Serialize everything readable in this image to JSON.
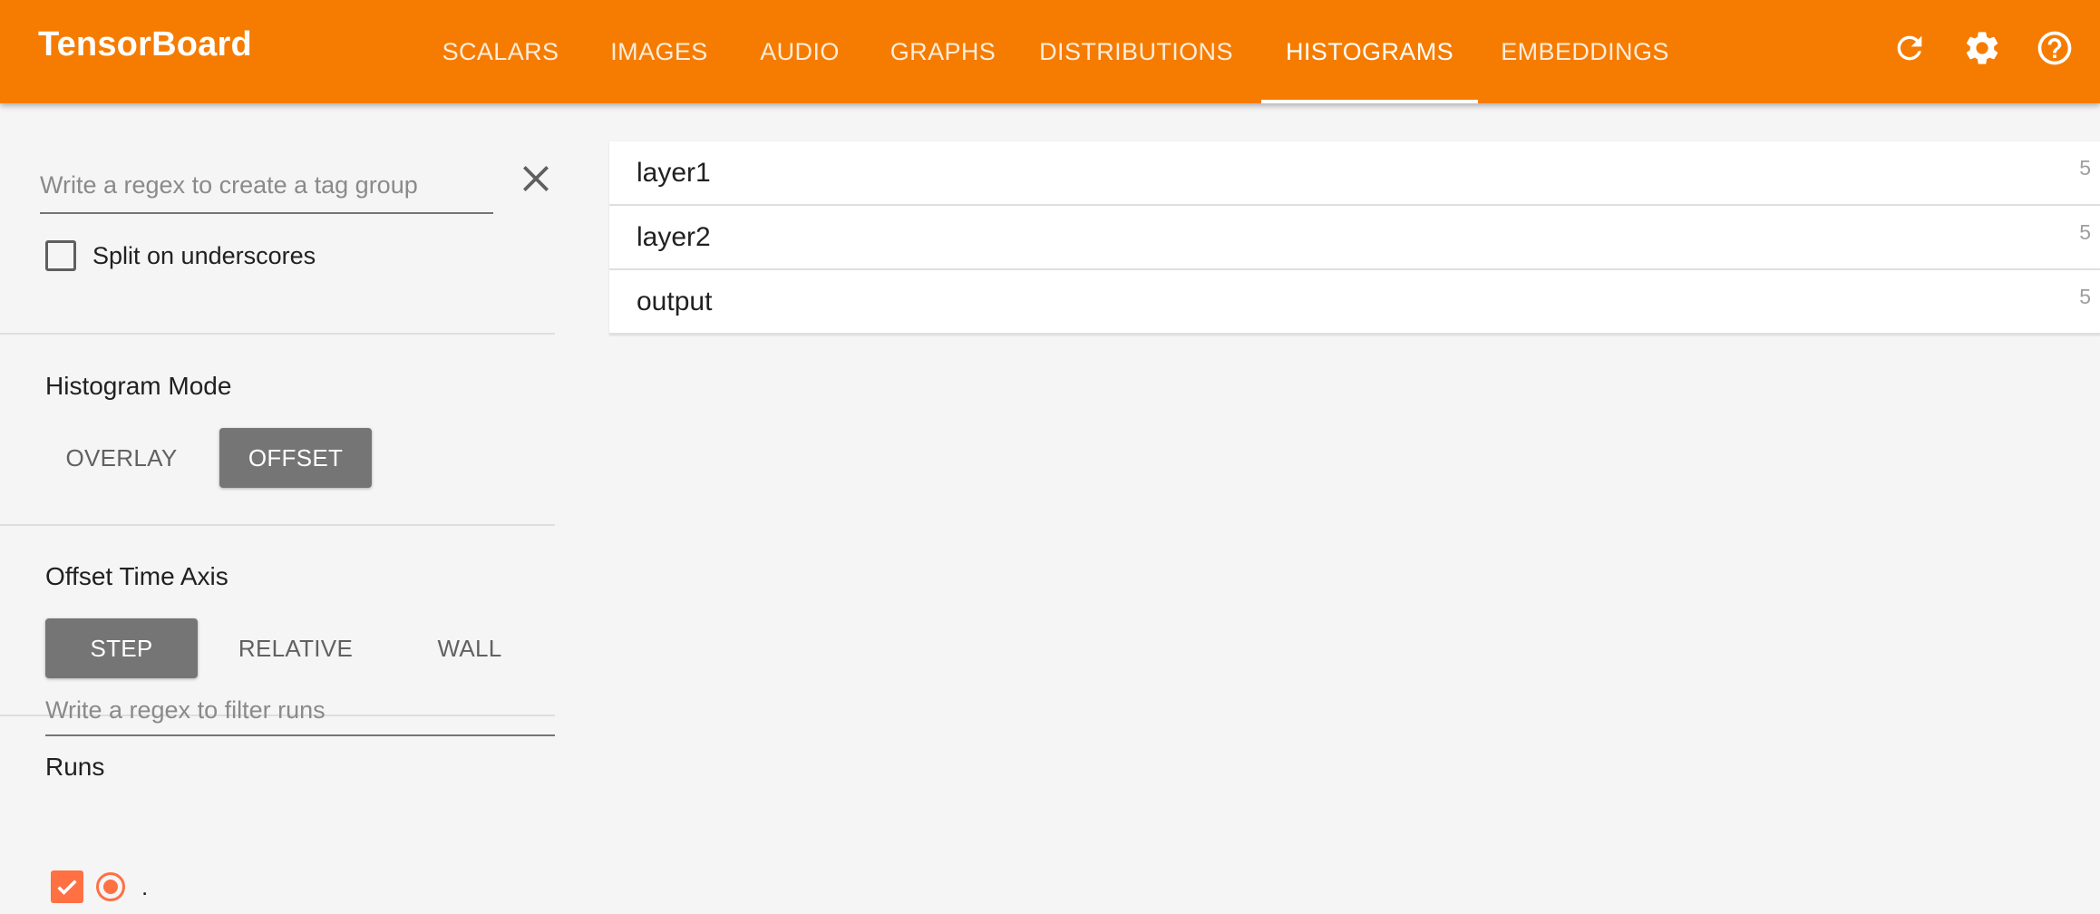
{
  "app": {
    "title": "TensorBoard"
  },
  "colors": {
    "header": "#f57c00",
    "run_accent": "#ff7043",
    "selected_toggle": "#757575"
  },
  "tabs": [
    {
      "label": "SCALARS",
      "active": false
    },
    {
      "label": "IMAGES",
      "active": false
    },
    {
      "label": "AUDIO",
      "active": false
    },
    {
      "label": "GRAPHS",
      "active": false
    },
    {
      "label": "DISTRIBUTIONS",
      "active": false
    },
    {
      "label": "HISTOGRAMS",
      "active": true
    },
    {
      "label": "EMBEDDINGS",
      "active": false
    }
  ],
  "header_icons": [
    "refresh-icon",
    "settings-icon",
    "help-icon"
  ],
  "sidebar": {
    "tag_regex": {
      "placeholder": "Write a regex to create a tag group",
      "value": ""
    },
    "split_underscores": {
      "label": "Split on underscores",
      "checked": false
    },
    "histogram_mode": {
      "title": "Histogram Mode",
      "options": [
        "OVERLAY",
        "OFFSET"
      ],
      "selected": "OFFSET"
    },
    "offset_time_axis": {
      "title": "Offset Time Axis",
      "options": [
        "STEP",
        "RELATIVE",
        "WALL"
      ],
      "selected": "STEP"
    },
    "runs": {
      "title": "Runs",
      "filter_placeholder": "Write a regex to filter runs",
      "items": [
        {
          "name": ".",
          "checked": true,
          "selected": true
        }
      ]
    }
  },
  "main": {
    "tags": [
      {
        "name": "layer1",
        "count": "5"
      },
      {
        "name": "layer2",
        "count": "5"
      },
      {
        "name": "output",
        "count": "5"
      }
    ]
  }
}
